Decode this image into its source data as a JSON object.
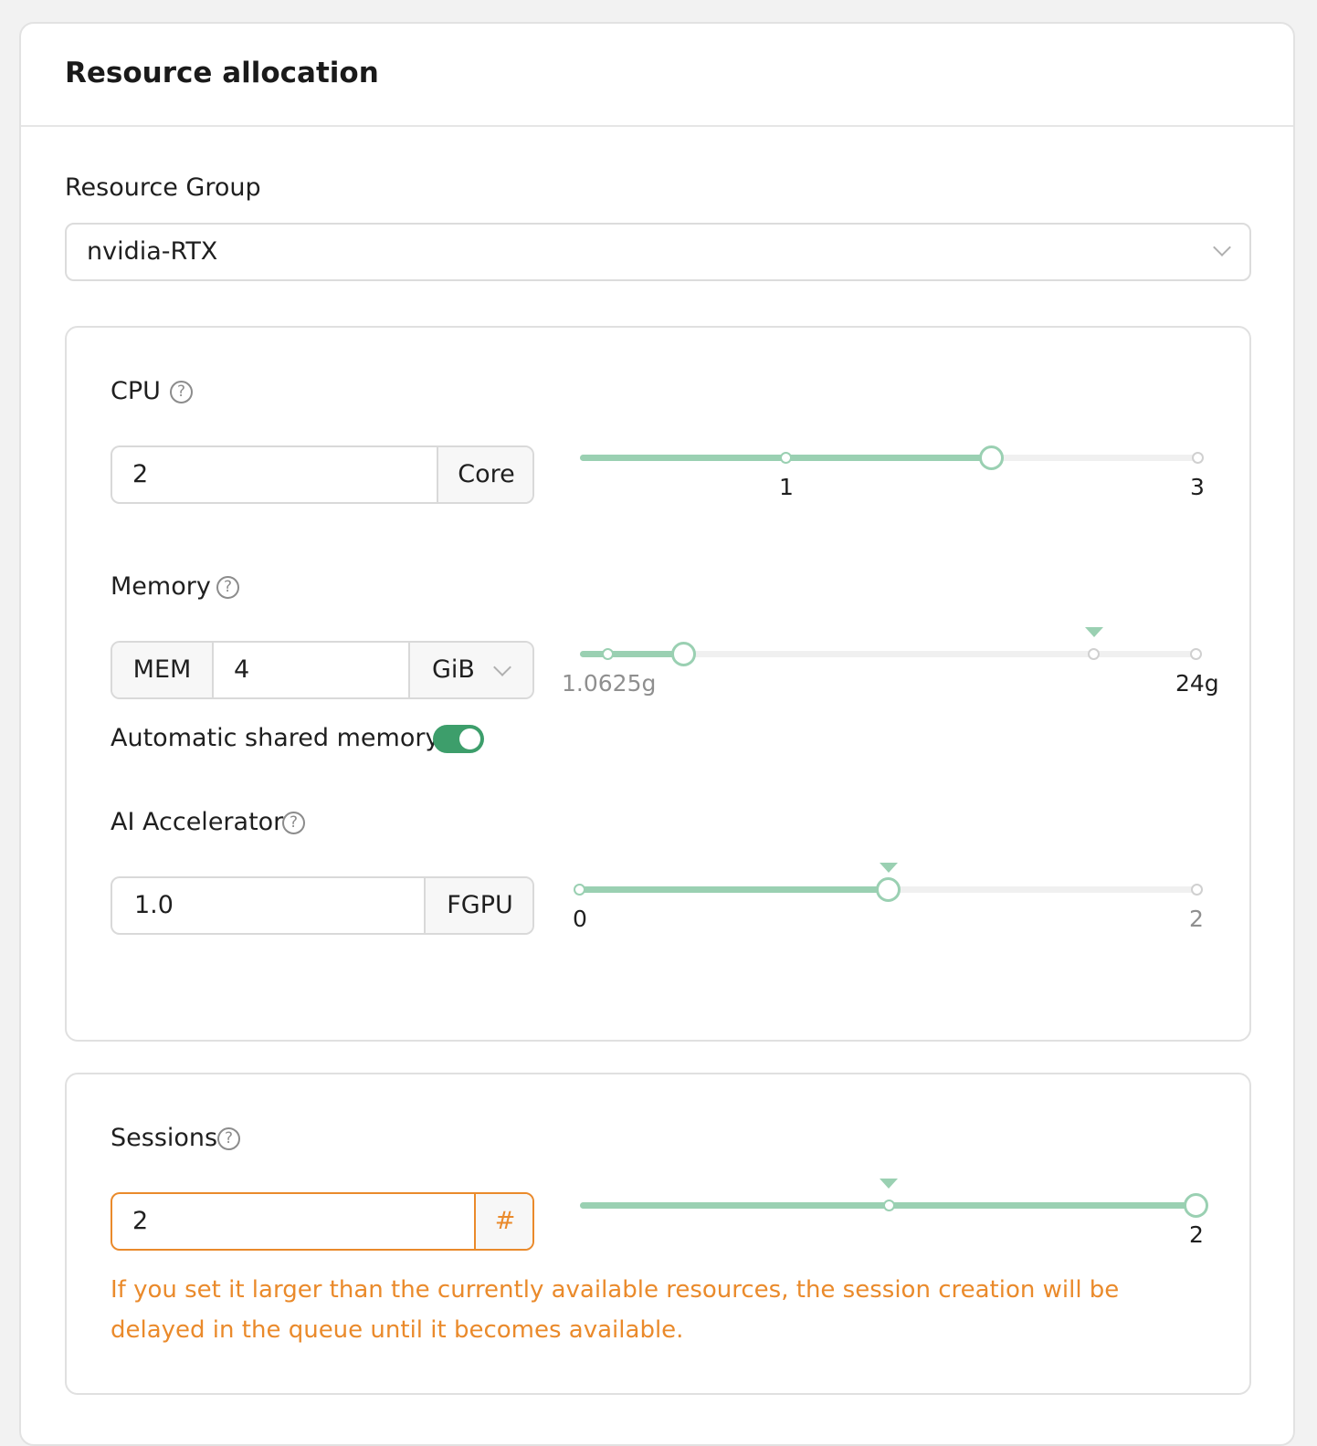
{
  "card": {
    "title": "Resource allocation"
  },
  "resource_group": {
    "label": "Resource Group",
    "value": "nvidia-RTX"
  },
  "cpu": {
    "label": "CPU",
    "value": "2",
    "unit": "Core",
    "slider": {
      "value": 2,
      "min_label": "1",
      "max_label": "3"
    }
  },
  "memory": {
    "label": "Memory",
    "prefix": "MEM",
    "value": "4",
    "unit": "GiB",
    "slider": {
      "value_gib": 4,
      "min_label": "1.0625g",
      "max_label": "24g"
    },
    "shared_memory": {
      "label": "Automatic shared memory",
      "enabled": true
    }
  },
  "accelerator": {
    "label": "AI Accelerator",
    "value": "1.0",
    "unit": "FGPU",
    "slider": {
      "value": 1.0,
      "min_label": "0",
      "max_label": "2"
    }
  },
  "sessions": {
    "label": "Sessions",
    "value": "2",
    "unit": "#",
    "slider": {
      "value": 2,
      "max_label": "2"
    },
    "warning": "If you set it larger than the currently available resources, the session creation will be delayed in the queue until it becomes available."
  },
  "colors": {
    "accent": "#9ad0b2",
    "toggle_on": "#3d9e6b",
    "warning": "#ea8a2b",
    "help_icon": "#8c8c8c"
  },
  "icons": [
    "help-icon",
    "chevron-down-icon"
  ]
}
